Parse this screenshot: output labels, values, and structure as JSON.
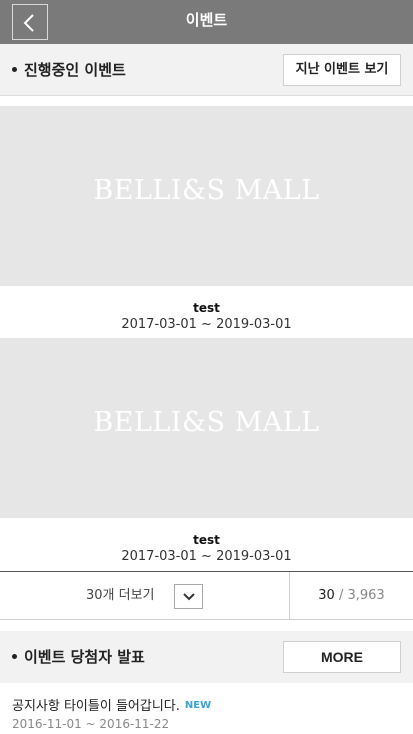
{
  "header": {
    "title": "이벤트",
    "back_icon": "chevron-left-icon"
  },
  "ongoing": {
    "title": "진행중인 이벤트",
    "past_button": "지난 이벤트 보기"
  },
  "events": [
    {
      "banner_text": "BELLI&S MALL",
      "name": "test",
      "period": "2017-03-01 ~ 2019-03-01"
    },
    {
      "banner_text": "BELLI&S MALL",
      "name": "test",
      "period": "2017-03-01 ~ 2019-03-01"
    }
  ],
  "pager": {
    "more_label": "30개 더보기",
    "chevron_icon": "chevron-down-icon",
    "current": "30",
    "total": "/ 3,963"
  },
  "winners": {
    "title": "이벤트 당첨자 발표",
    "more_button": "MORE"
  },
  "notice": {
    "title": "공지사항 타이틀이 들어갑니다.",
    "badge": "NEW",
    "period": "2016-11-01 ~ 2016-11-22"
  },
  "colors": {
    "topbar": "#7a7a7a",
    "section_bg": "#f2f2f2",
    "banner_bg": "#e6e6e6",
    "new_badge": "#3aa3d8"
  }
}
